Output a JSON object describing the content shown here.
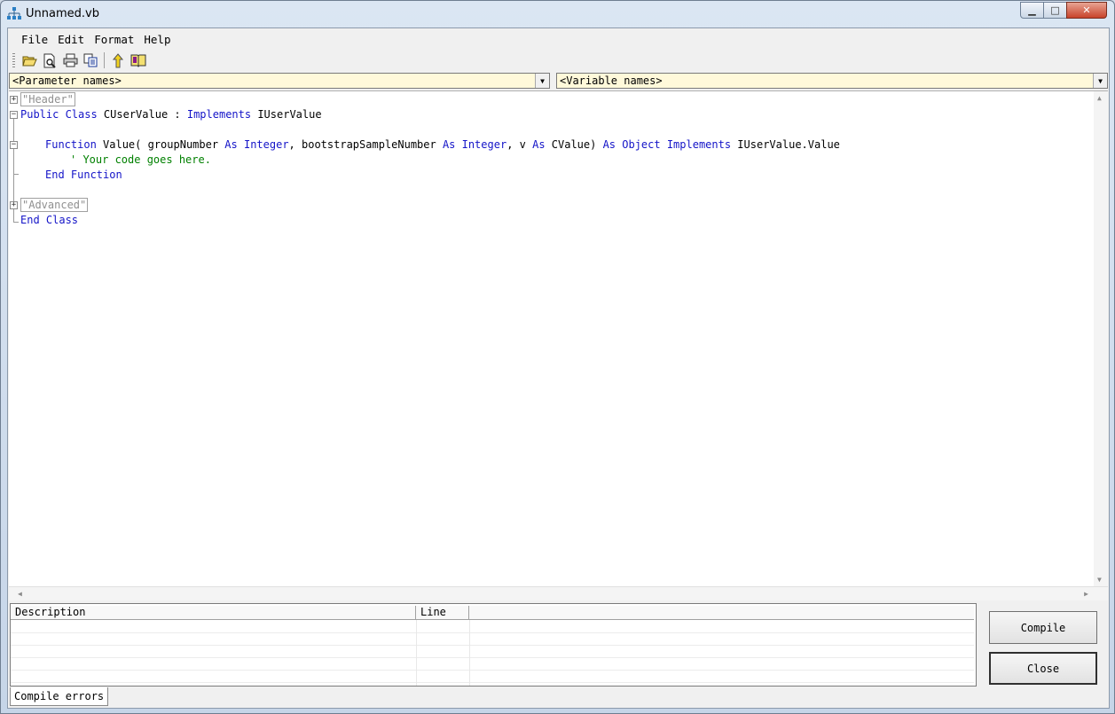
{
  "window": {
    "title": "Unnamed.vb"
  },
  "menu": [
    "File",
    "Edit",
    "Format",
    "Help"
  ],
  "toolbar": {
    "icons": [
      "open-folder-icon",
      "print-preview-icon",
      "print-icon",
      "copy-icon",
      "up-arrow-icon",
      "book-icon"
    ]
  },
  "combos": {
    "parameters": "<Parameter names>",
    "variables": "<Variable names>"
  },
  "code": {
    "header_region": "\"Header\"",
    "line_class_1": "Public Class",
    "line_class_2": " CUserValue : ",
    "line_class_3": "Implements",
    "line_class_4": " IUserValue",
    "fn_1": "Function",
    "fn_2": " Value( groupNumber ",
    "fn_3": "As Integer",
    "fn_4": ", bootstrapSampleNumber ",
    "fn_5": "As Integer",
    "fn_6": ", v ",
    "fn_7": "As",
    "fn_8": " CValue) ",
    "fn_9": "As Object Implements",
    "fn_10": " IUserValue.Value",
    "comment": "' Your code goes here.",
    "end_function": "End Function",
    "advanced_region": "\"Advanced\"",
    "end_class": "End Class"
  },
  "errors": {
    "columns": [
      "Description",
      "Line"
    ],
    "rows": []
  },
  "tabs": {
    "compile_errors": "Compile errors"
  },
  "buttons": {
    "compile": "Compile",
    "close": "Close"
  }
}
